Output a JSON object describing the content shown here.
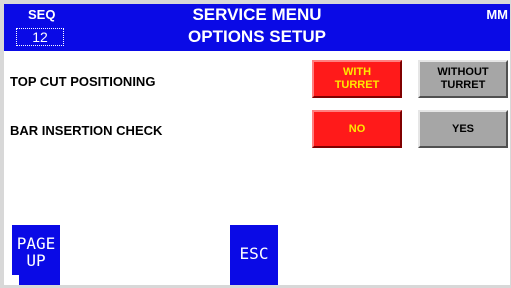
{
  "header": {
    "seq_label": "SEQ",
    "seq_value": "12",
    "title_line1": "SERVICE MENU",
    "title_line2": "OPTIONS SETUP",
    "unit": "MM",
    "background_color": "#0a0ae6"
  },
  "options": [
    {
      "label": "TOP CUT POSITIONING",
      "buttons": [
        {
          "label_line1": "WITH",
          "label_line2": "TURRET",
          "state": "selected",
          "color": "#ff1a1a"
        },
        {
          "label_line1": "WITHOUT",
          "label_line2": "TURRET",
          "state": "unselected",
          "color": "#a6a6a6"
        }
      ]
    },
    {
      "label": "BAR INSERTION CHECK",
      "buttons": [
        {
          "label_line1": "NO",
          "label_line2": "",
          "state": "selected",
          "color": "#ff1a1a"
        },
        {
          "label_line1": "YES",
          "label_line2": "",
          "state": "unselected",
          "color": "#a6a6a6"
        }
      ]
    }
  ],
  "navigation": {
    "page_up_label": "PAGE\nUP",
    "esc_label": "ESC"
  },
  "colors": {
    "selected_text": "#ffe800",
    "unselected_text": "#000000"
  }
}
